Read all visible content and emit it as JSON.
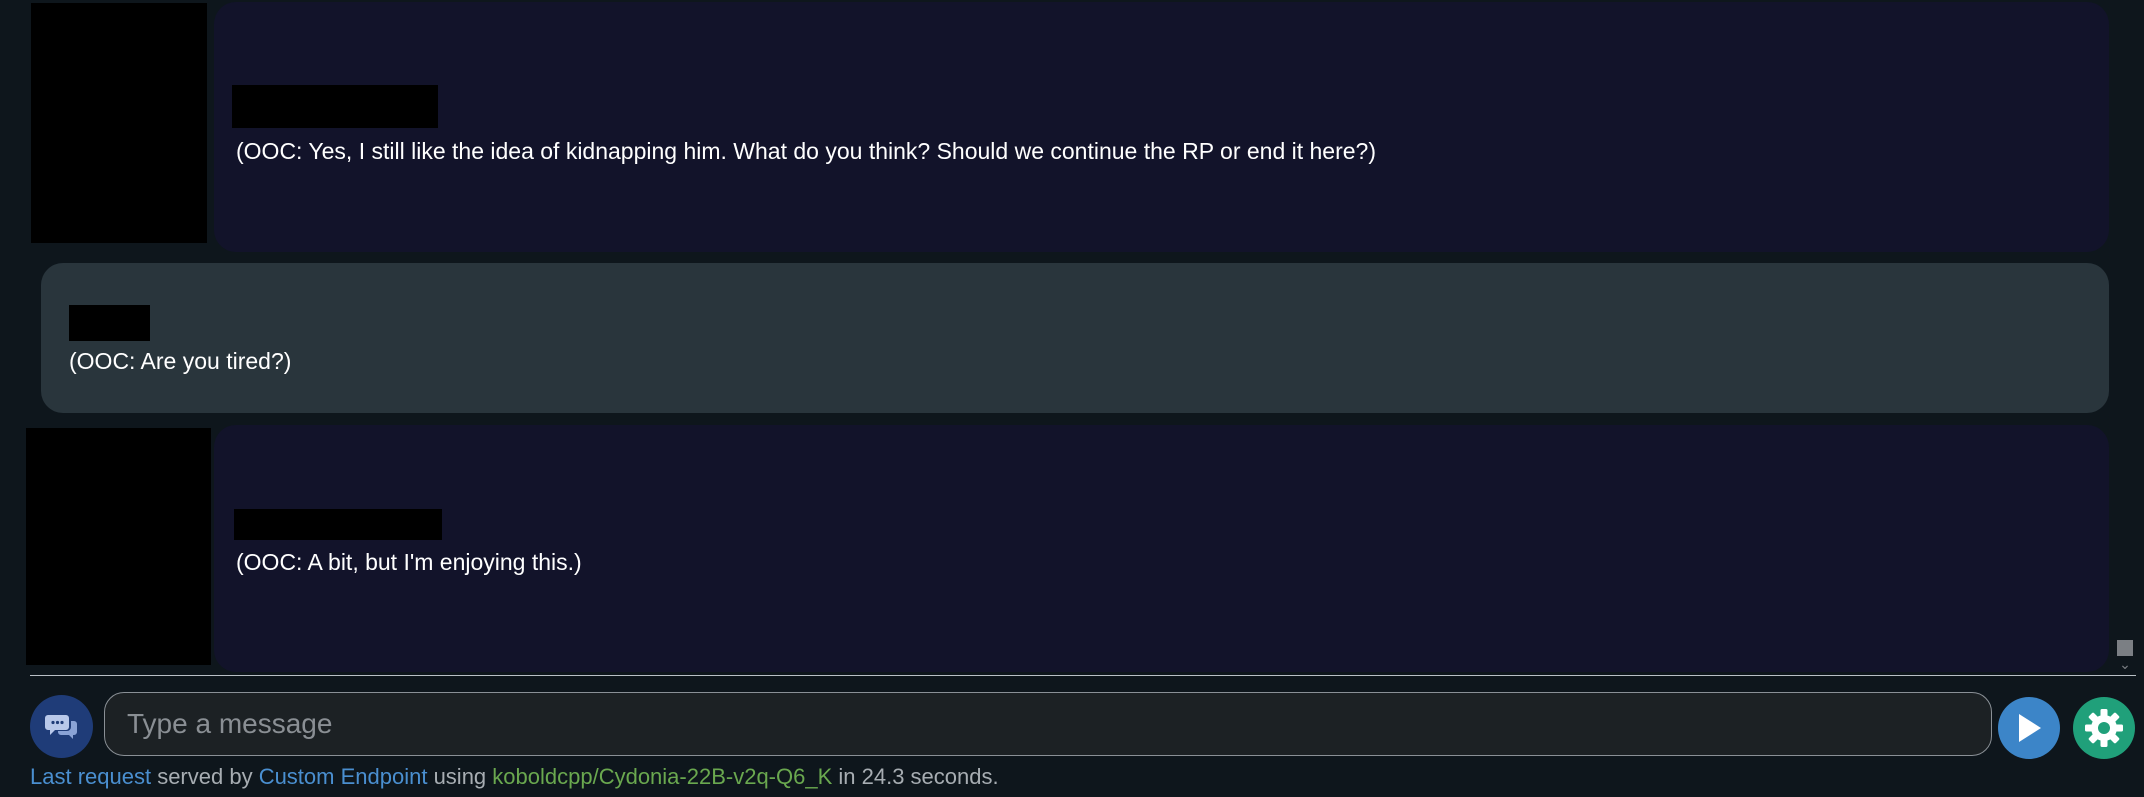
{
  "messages": [
    {
      "role": "character",
      "text": " (OOC: Yes, I still like the idea of kidnapping him. What do you think? Should we continue the RP or end it here?)"
    },
    {
      "role": "user",
      "text": "(OOC: Are you tired?)"
    },
    {
      "role": "character",
      "text": " (OOC: A bit, but I'm enjoying this.)"
    }
  ],
  "composer": {
    "placeholder": "Type a message",
    "value": ""
  },
  "status": {
    "last_request": "Last request",
    "served_by": " served by ",
    "endpoint": "Custom Endpoint",
    "using": " using ",
    "model": "koboldcpp/Cydonia-22B-v2q-Q6_K",
    "duration": " in 24.3 seconds."
  },
  "icons": {
    "chat": "chat-bubbles-icon",
    "send": "play-icon",
    "settings": "gear-icon"
  },
  "colors": {
    "background": "#0e161c",
    "bot_bubble": "#12132a",
    "user_bubble": "#29353c",
    "link": "#4a8fd0",
    "model": "#6aa84f",
    "send_button": "#3c85c8",
    "settings_button": "#20a07a",
    "chat_button": "#1f3c78"
  }
}
